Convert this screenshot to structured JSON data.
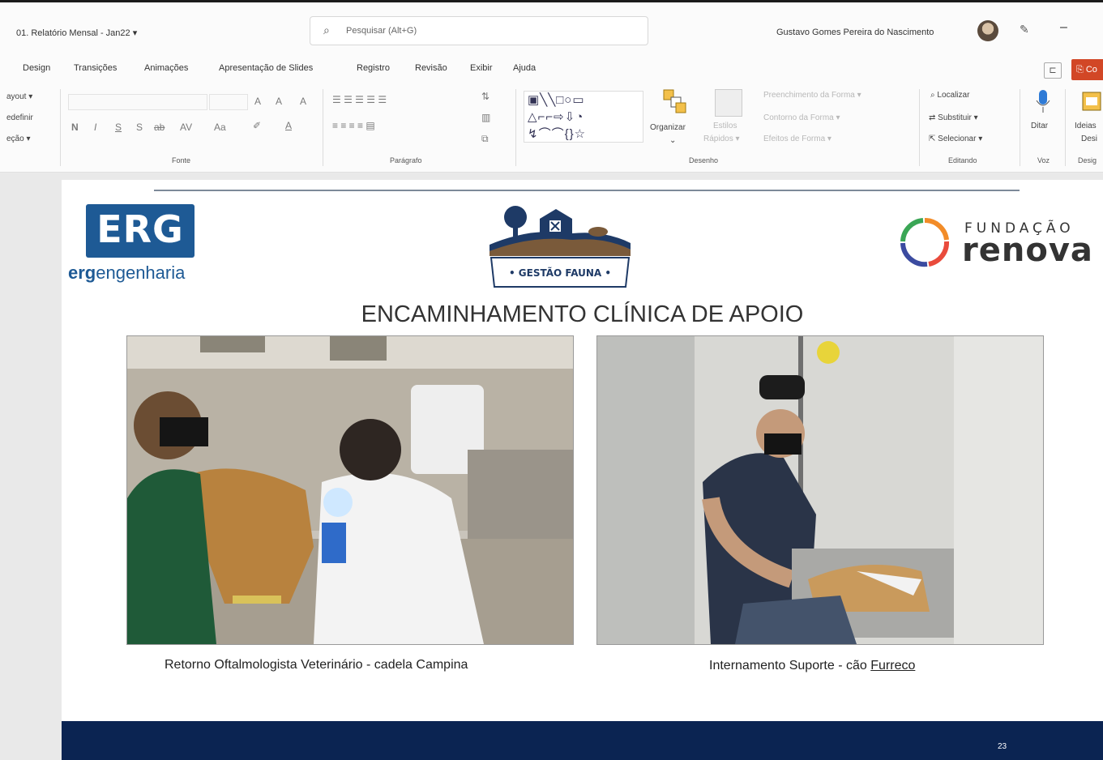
{
  "titlebar": {
    "doc_title": "01. Relatório Mensal - Jan22 ▾",
    "search_placeholder": "Pesquisar (Alt+G)",
    "user_name": "Gustavo Gomes Pereira do Nascimento",
    "minimize": "–"
  },
  "tabs": [
    "Design",
    "Transições",
    "Animações",
    "Apresentação de Slides",
    "Registro",
    "Revisão",
    "Exibir",
    "Ajuda"
  ],
  "share_label": "Co",
  "ribbon": {
    "left_items": [
      "ayout ▾",
      "edefinir",
      "eção ▾"
    ],
    "font_group_label": "Fonte",
    "paragraph_group_label": "Parágrafo",
    "drawing_group_label": "Desenho",
    "editing_group_label": "Editando",
    "voice_group_label": "Voz",
    "designer_group_label": "Desig",
    "organize_label": "Organizar",
    "quick_styles_label": [
      "Estilos",
      "Rápidos ▾"
    ],
    "shape_fill": "Preenchimento da Forma ▾",
    "shape_outline": "Contorno da Forma ▾",
    "shape_effects": "Efeitos de Forma ▾",
    "find": "Localizar",
    "replace": "Substituir ▾",
    "select": "Selecionar ▾",
    "dictate": "Ditar",
    "ideas": [
      "Ideias",
      "Desi"
    ],
    "font_buttons": [
      "N",
      "I",
      "S",
      "S",
      "ab",
      "AV",
      "Aa"
    ],
    "font_size_buttons": [
      "A",
      "A",
      "A"
    ]
  },
  "slide": {
    "erg_logo_text": "ERG",
    "erg_sub_bold": "erg",
    "erg_sub_rest": "engenharia",
    "fauna_label": "• GESTÃO FAUNA •",
    "renova_fund": "FUNDAÇÃO",
    "renova_name": "renova",
    "title": "ENCAMINHAMENTO CLÍNICA DE APOIO",
    "caption_left": "Retorno Oftalmologista Veterinário - cadela Campina",
    "caption_right_prefix": "Internamento Suporte - cão ",
    "caption_right_name": "Furreco",
    "page_number": "23"
  },
  "colors": {
    "erg_blue": "#1e5a95",
    "footer_navy": "#0b2452",
    "share_orange": "#d24726"
  }
}
